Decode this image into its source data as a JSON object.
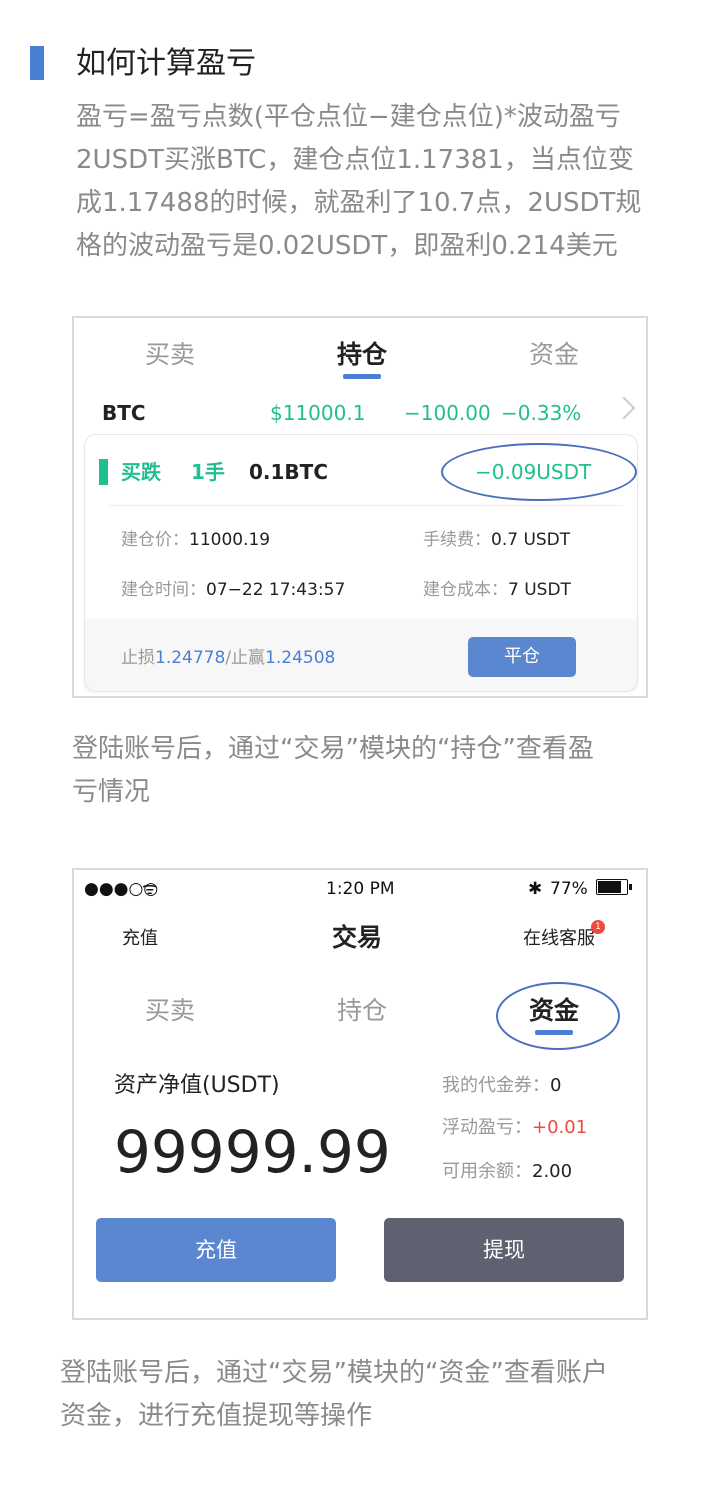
{
  "section": {
    "title": "如何计算盈亏",
    "desc_lines": [
      "盈亏=盈亏点数(平仓点位−建仓点位)*波动盈亏",
      "2USDT买涨BTC，建仓点位1.17381，当点位变",
      "成1.17488的时候，就盈利了10.7点，2USDT规",
      "格的波动盈亏是0.02USDT，即盈利0.214美元"
    ]
  },
  "card1": {
    "tabs": [
      "买卖",
      "持仓",
      "资金"
    ],
    "active_tab": "持仓",
    "position": {
      "symbol": "BTC",
      "price": "$11000.1",
      "change": "−100.00",
      "change_pct": "−0.33%"
    },
    "order": {
      "direction": "买跌",
      "lots": "1手",
      "amount": "0.1BTC",
      "pnl": "−0.09USDT",
      "open_price_label": "建仓价：",
      "open_price": "11000.19",
      "fee_label": "手续费：",
      "fee": "0.7 USDT",
      "open_time_label": "建仓时间：",
      "open_time": "07−22 17:43:57",
      "cost_label": "建仓成本：",
      "cost": "7 USDT",
      "stop_loss_label": "止损",
      "stop_loss": "1.24778",
      "slash": "/",
      "take_profit_label": "止赢",
      "take_profit": "1.24508",
      "close_button": "平仓"
    }
  },
  "caption1_lines": [
    "登陆账号后，通过“交易”模块的“持仓”查看盈",
    "亏情况"
  ],
  "card2": {
    "status_bar": {
      "signal": "●●●○○",
      "wifi": "ᯤ",
      "time": "1:20 PM",
      "bluetooth": "✱",
      "battery": "77%",
      "battery_level": 0.77
    },
    "nav": {
      "left": "充值",
      "title": "交易",
      "right": "在线客服",
      "badge": "1"
    },
    "tabs": [
      "买卖",
      "持仓",
      "资金"
    ],
    "active_tab": "资金",
    "assets_label": "资产净值(USDT)",
    "assets_value": "99999.99",
    "voucher_label": "我的代金券：",
    "voucher_value": "0",
    "float_pnl_label": "浮动盈亏：",
    "float_pnl_value": "+0.01",
    "available_label": "可用余额：",
    "available_value": "2.00",
    "deposit_button": "充值",
    "withdraw_button": "提现"
  },
  "caption2_lines": [
    "登陆账号后，通过“交易”模块的“资金”查看账户",
    "资金，进行充值提现等操作"
  ],
  "colors": {
    "accent": "#4b7fd6",
    "green": "#1fbf8f",
    "red": "#f04a3e",
    "gray_button": "#5e6170"
  }
}
